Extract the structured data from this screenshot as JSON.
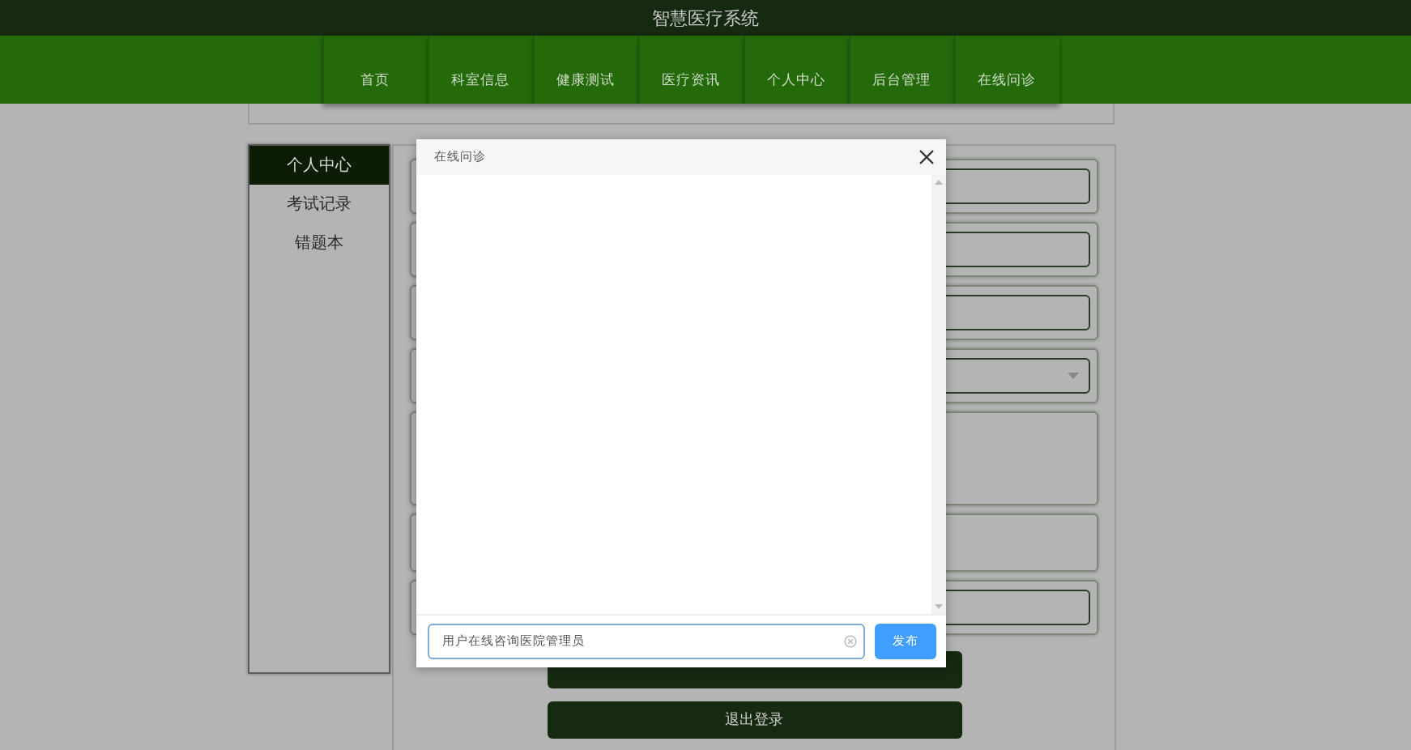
{
  "header": {
    "title": "智慧医疗系统"
  },
  "nav": [
    {
      "label": "首页"
    },
    {
      "label": "科室信息"
    },
    {
      "label": "健康测试"
    },
    {
      "label": "医疗资讯"
    },
    {
      "label": "个人中心"
    },
    {
      "label": "后台管理"
    },
    {
      "label": "在线问诊"
    }
  ],
  "sidebar": {
    "items": [
      {
        "label": "个人中心",
        "selected": true
      },
      {
        "label": "考试记录",
        "selected": false
      },
      {
        "label": "错题本",
        "selected": false
      }
    ]
  },
  "form": {
    "fields": [
      {
        "kind": "input"
      },
      {
        "kind": "input"
      },
      {
        "kind": "input"
      },
      {
        "kind": "select"
      },
      {
        "kind": "textarea"
      },
      {
        "kind": "textarea"
      },
      {
        "kind": "input"
      }
    ],
    "buttons": [
      {
        "kind": "update"
      },
      {
        "kind": "logout",
        "label": "退出登录"
      }
    ]
  },
  "dialog": {
    "title": "在线问诊",
    "message": {
      "value": "用户在线咨询医院管理员"
    },
    "send_button": "发布"
  }
}
